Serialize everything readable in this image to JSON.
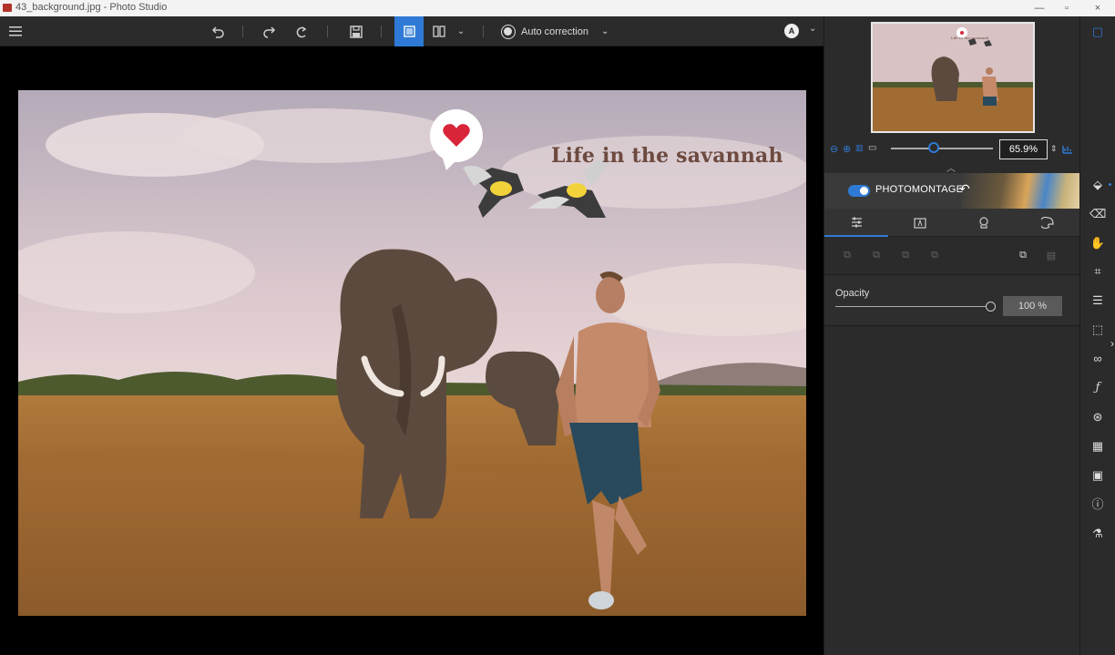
{
  "window": {
    "title": "43_background.jpg - Photo Studio",
    "minimize_label": "—",
    "maximize_label": "▫",
    "close_label": "×"
  },
  "toolbar": {
    "auto_correction_label": "Auto correction",
    "user_initial": "A",
    "icons": [
      "menu-icon",
      "undo-icon",
      "redo-icon",
      "redo-all-icon",
      "save-icon",
      "single-view-icon",
      "split-view-icon",
      "chevron-down-icon"
    ]
  },
  "image": {
    "overlay_text": "Life in the savannah",
    "thumbnail_text": "Life in the savannah"
  },
  "navigator": {
    "zoom_value": "65.9%",
    "zoom_slider_fraction": 0.42
  },
  "photomontage": {
    "label": "PHOTOMONTAGE",
    "enabled": true
  },
  "panel_tabs": [
    {
      "name": "adjust-tab",
      "icon": "sliders-icon",
      "active": true
    },
    {
      "name": "text-tab",
      "icon": "text-frame-icon",
      "active": false
    },
    {
      "name": "stamp-tab",
      "icon": "stamp-icon",
      "active": false
    },
    {
      "name": "effects-tab",
      "icon": "palette-icon",
      "active": false
    }
  ],
  "opacity": {
    "label": "Opacity",
    "value_text": "100 %",
    "value": 100
  },
  "colors": {
    "accent": "#2f7ad6",
    "panel_bg": "#2b2b2b",
    "title_text": "#6d4a40"
  }
}
